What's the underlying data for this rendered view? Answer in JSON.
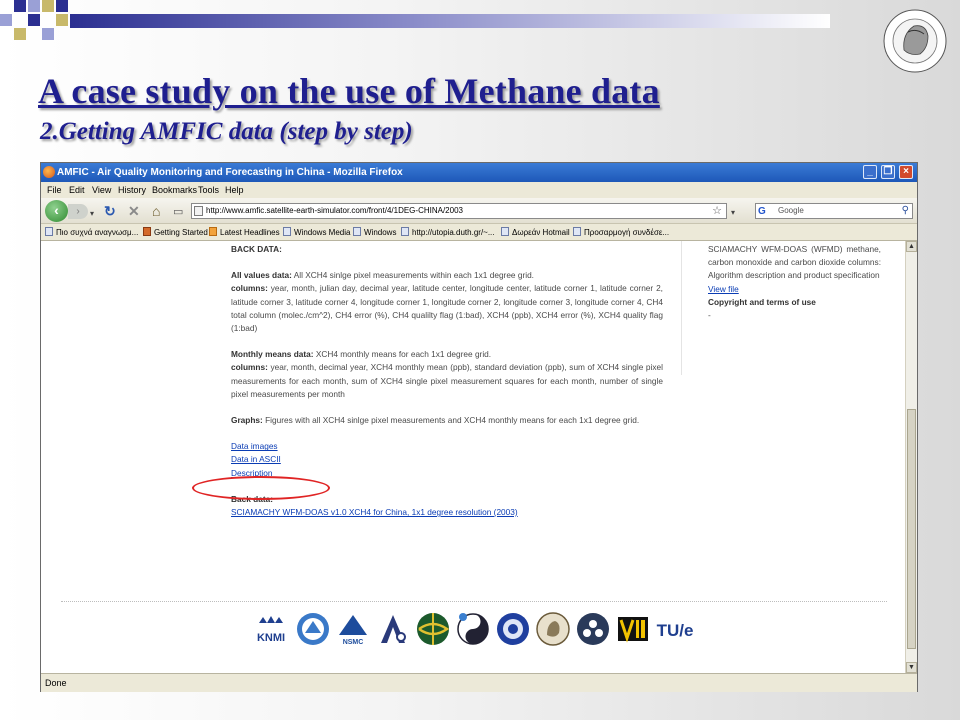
{
  "slide": {
    "title": "A case study on the use of Methane data",
    "subtitle": "2.Getting AMFIC data (step by step)"
  },
  "browser": {
    "window_title": "AMFIC - Air Quality Monitoring and Forecasting in China - Mozilla Firefox",
    "menu": [
      "File",
      "Edit",
      "View",
      "History",
      "Bookmarks",
      "Tools",
      "Help"
    ],
    "url": "http://www.amfic.satellite-earth-simulator.com/front/4/1DEG-CHINA/2003",
    "search_placeholder": "Google",
    "bookmarks": [
      "Πιο συχνά αναγνωσμ...",
      "Getting Started",
      "Latest Headlines",
      "Windows Media",
      "Windows",
      "http://utopia.duth.gr/~...",
      "Δωρεάν Hotmail",
      "Προσαρμογή συνδέσε..."
    ],
    "status": "Done"
  },
  "page": {
    "back_data_heading": "BACK DATA:",
    "all_values_label": "All values data:",
    "all_values_text": " All XCH4 sinlge pixel measurements within each 1x1 degree grid.",
    "columns_label": "columns:",
    "all_values_columns": " year, month, julian day, decimal year, latitude center, longitude center, latitude corner 1, latitude corner 2, latitude corner 3, latitude corner 4, longitude corner 1, longitude corner 2, longitude corner 3, longitude corner 4, CH4 total column (molec./cm^2), CH4 error (%), CH4 qualilty flag (1:bad), XCH4 (ppb), XCH4 error (%), XCH4 quality flag (1:bad)",
    "monthly_label": "Monthly means data:",
    "monthly_text": " XCH4 monthly means for each 1x1 degree grid.",
    "monthly_columns": " year, month, decimal year, XCH4 monthly mean (ppb), standard deviation (ppb), sum of XCH4 single pixel measurements for each month, sum of XCH4 single pixel measurement squares for each month, number of single pixel measurements per month",
    "graphs_label": "Graphs:",
    "graphs_text": " Figures with all XCH4 sinlge pixel measurements and XCH4 monthly means for each 1x1 degree grid.",
    "links": [
      "Data images",
      "Data in ASCII",
      "Description"
    ],
    "back_data_label": "Back data:",
    "back_data_link": "SCIAMACHY WFM-DOAS v1.0 XCH4 for China, 1x1 degree resolution (2003)",
    "sidebar_text": "SCIAMACHY WFM-DOAS (WFMD) methane, carbon monoxide and carbon dioxide columns: Algorithm description and product specification",
    "sidebar_link": "View file",
    "sidebar_copyright": "Copyright and terms of use",
    "sidebar_dash": "-",
    "logos": [
      "KNMI",
      "NSMC",
      "TU/e"
    ]
  },
  "colors": {
    "title": "#1f1f8f",
    "link": "#0a3cb4",
    "highlight_ellipse": "#e02424"
  }
}
